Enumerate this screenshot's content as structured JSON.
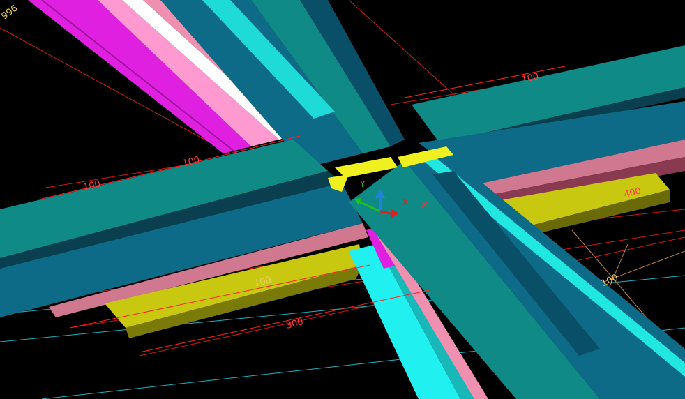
{
  "viewport": {
    "background": "#000000",
    "tool": "3D CAD model viewport — steel connection node"
  },
  "colors": {
    "beam_teal": "#0f8a86",
    "beam_blue": "#0e6b88",
    "beam_dark": "#0a4f68",
    "pink": "#f090b0",
    "magenta": "#e020e0",
    "yellow": "#c8c810",
    "cyan": "#20f0f0",
    "gusset": "#f0f020",
    "dim_red": "#ff2020",
    "dim_cyan": "#20c8d0",
    "dim_orange": "#e8a050"
  },
  "dimensions": {
    "top_left_label": "996",
    "left_a": "100",
    "left_b": "100",
    "right_top": "100",
    "right_yellow": "400",
    "bottom_300": "300",
    "right_100": "100",
    "center_small": "100",
    "mid_yellow": "100"
  },
  "ucs": {
    "x_label": "X",
    "y_label": "Y",
    "x_color": "#e02020",
    "y_color": "#20c020",
    "z_color": "#2080e0"
  }
}
